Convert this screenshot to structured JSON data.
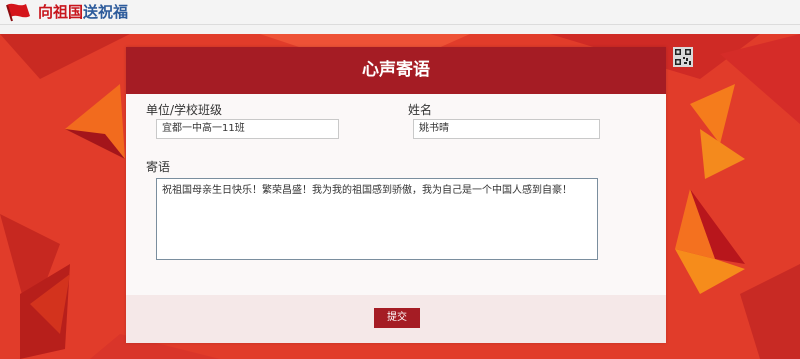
{
  "header": {
    "title_red": "向祖国",
    "title_blue": "送祝福",
    "icon": "red-flag-icon"
  },
  "form": {
    "heading": "心声寄语",
    "unit_label": "单位/学校班级",
    "unit_value": "宜都一中高一11班",
    "name_label": "姓名",
    "name_value": "姚书晴",
    "message_label": "寄语",
    "message_value": "祝祖国母亲生日快乐！繁荣昌盛！我为我的祖国感到骄傲，我为自己是一个中国人感到自豪！",
    "submit_label": "提交"
  },
  "icons": {
    "qr": "qr-code-icon"
  },
  "colors": {
    "brand_red": "#a51c24",
    "bg_red": "#e13c2a",
    "title_blue": "#2d5b9b"
  }
}
